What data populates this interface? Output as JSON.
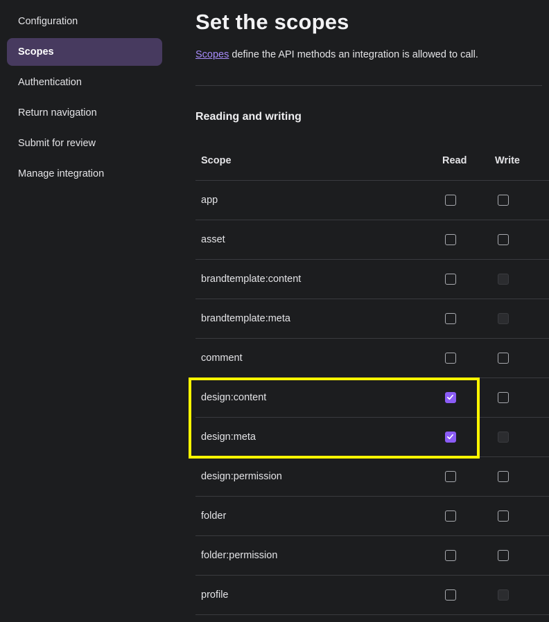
{
  "sidebar": {
    "items": [
      {
        "label": "Configuration",
        "active": false
      },
      {
        "label": "Scopes",
        "active": true
      },
      {
        "label": "Authentication",
        "active": false
      },
      {
        "label": "Return navigation",
        "active": false
      },
      {
        "label": "Submit for review",
        "active": false
      },
      {
        "label": "Manage integration",
        "active": false
      }
    ]
  },
  "main": {
    "title": "Set the scopes",
    "intro_link": "Scopes",
    "intro_text": " define the API methods an integration is allowed to call.",
    "section_title": "Reading and writing",
    "table": {
      "headers": {
        "scope": "Scope",
        "read": "Read",
        "write": "Write"
      },
      "rows": [
        {
          "scope": "app",
          "read": "unchecked",
          "write": "unchecked"
        },
        {
          "scope": "asset",
          "read": "unchecked",
          "write": "unchecked"
        },
        {
          "scope": "brandtemplate:content",
          "read": "unchecked",
          "write": "disabled"
        },
        {
          "scope": "brandtemplate:meta",
          "read": "unchecked",
          "write": "disabled"
        },
        {
          "scope": "comment",
          "read": "unchecked",
          "write": "unchecked"
        },
        {
          "scope": "design:content",
          "read": "checked",
          "write": "unchecked"
        },
        {
          "scope": "design:meta",
          "read": "checked",
          "write": "disabled"
        },
        {
          "scope": "design:permission",
          "read": "unchecked",
          "write": "unchecked"
        },
        {
          "scope": "folder",
          "read": "unchecked",
          "write": "unchecked"
        },
        {
          "scope": "folder:permission",
          "read": "unchecked",
          "write": "unchecked"
        },
        {
          "scope": "profile",
          "read": "unchecked",
          "write": "disabled"
        }
      ]
    }
  },
  "colors": {
    "background": "#1c1d1f",
    "active_nav": "#473a5f",
    "accent": "#8b5cf6",
    "link": "#a78bfa",
    "highlight": "#fff500"
  }
}
